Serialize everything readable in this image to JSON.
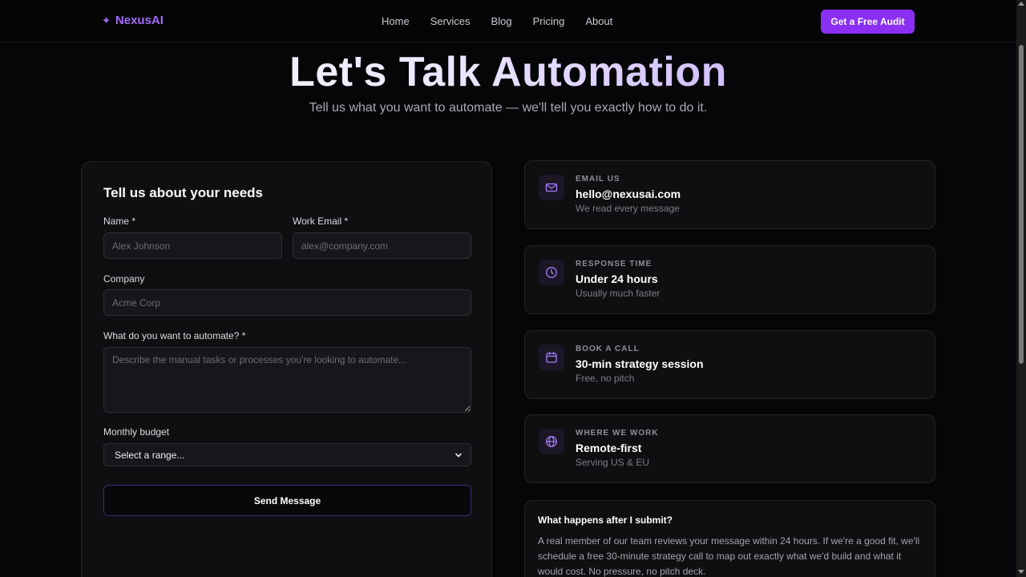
{
  "nav": {
    "logo_text": "NexusAI",
    "logo_icon": "sparkle-icon",
    "links": [
      "Home",
      "Services",
      "Blog",
      "Pricing",
      "About"
    ],
    "cta_label": "Get a Free Audit"
  },
  "colors": {
    "accent": "#8b2ff5",
    "logo": "#a46bff",
    "background": "#060608",
    "card": "#0f0f12"
  },
  "hero": {
    "title": "Let's Talk Automation",
    "subtitle": "Tell us what you want to automate — we'll tell you exactly how to do it."
  },
  "form": {
    "title": "Tell us about your needs",
    "name_label": "Name *",
    "name_placeholder": "Alex Johnson",
    "email_label": "Work Email *",
    "email_placeholder": "alex@company.com",
    "company_label": "Company",
    "company_placeholder": "Acme Corp",
    "automate_label": "What do you want to automate? *",
    "automate_placeholder": "Describe the manual tasks or processes you're looking to automate...",
    "budget_label": "Monthly budget",
    "budget_selected": "Select a range...",
    "submit_label": "Send Message"
  },
  "info": [
    {
      "icon": "mail-icon",
      "label": "EMAIL US",
      "value": "hello@nexusai.com",
      "sub": "We read every message"
    },
    {
      "icon": "clock-icon",
      "label": "RESPONSE TIME",
      "value": "Under 24 hours",
      "sub": "Usually much faster"
    },
    {
      "icon": "calendar-icon",
      "label": "BOOK A CALL",
      "value": "30-min strategy session",
      "sub": "Free, no pitch"
    },
    {
      "icon": "globe-icon",
      "label": "WHERE WE WORK",
      "value": "Remote-first",
      "sub": "Serving US & EU"
    }
  ],
  "faq": {
    "question": "What happens after I submit?",
    "answer": "A real member of our team reviews your message within 24 hours. If we're a good fit, we'll schedule a free 30-minute strategy call to map out exactly what we'd build and what it would cost. No pressure, no pitch deck."
  }
}
